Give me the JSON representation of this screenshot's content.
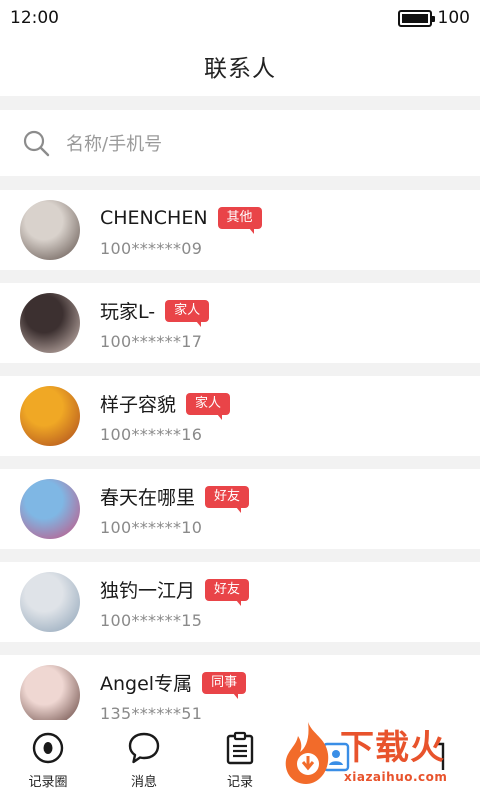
{
  "status_bar": {
    "time": "12:00",
    "battery": "100"
  },
  "header": {
    "title": "联系人"
  },
  "search": {
    "placeholder": "名称/手机号"
  },
  "contacts": [
    {
      "name": "CHENCHEN",
      "tag": "其他",
      "phone": "100******09",
      "avatar_colors": [
        "#d9d2cc",
        "#5a4c46"
      ]
    },
    {
      "name": "玩家L-",
      "tag": "家人",
      "phone": "100******17",
      "avatar_colors": [
        "#3c3030",
        "#d7c4bd"
      ]
    },
    {
      "name": "样子容貌",
      "tag": "家人",
      "phone": "100******16",
      "avatar_colors": [
        "#f0a825",
        "#a8461e"
      ]
    },
    {
      "name": "春天在哪里",
      "tag": "好友",
      "phone": "100******10",
      "avatar_colors": [
        "#7fb7e4",
        "#c94d7b"
      ]
    },
    {
      "name": "独钓一江月",
      "tag": "好友",
      "phone": "100******15",
      "avatar_colors": [
        "#dfe3e8",
        "#8aa0b5"
      ]
    },
    {
      "name": "Angel专属",
      "tag": "同事",
      "phone": "135******51",
      "avatar_colors": [
        "#efd7d2",
        "#5a3a35"
      ]
    }
  ],
  "tabbar": {
    "items": [
      {
        "label": "记录圈",
        "icon": "eye-circle-icon"
      },
      {
        "label": "消息",
        "icon": "chat-bubble-icon"
      },
      {
        "label": "记录",
        "icon": "clipboard-icon"
      },
      {
        "label": "",
        "icon": "contacts-icon"
      },
      {
        "label": "",
        "icon": "profile-icon"
      }
    ]
  },
  "watermark": {
    "text": "下载火",
    "url": "xiazaihuo.com"
  },
  "colors": {
    "tag": "#e94448",
    "accent": "#e8532c",
    "divider": "#f2f2f2"
  }
}
